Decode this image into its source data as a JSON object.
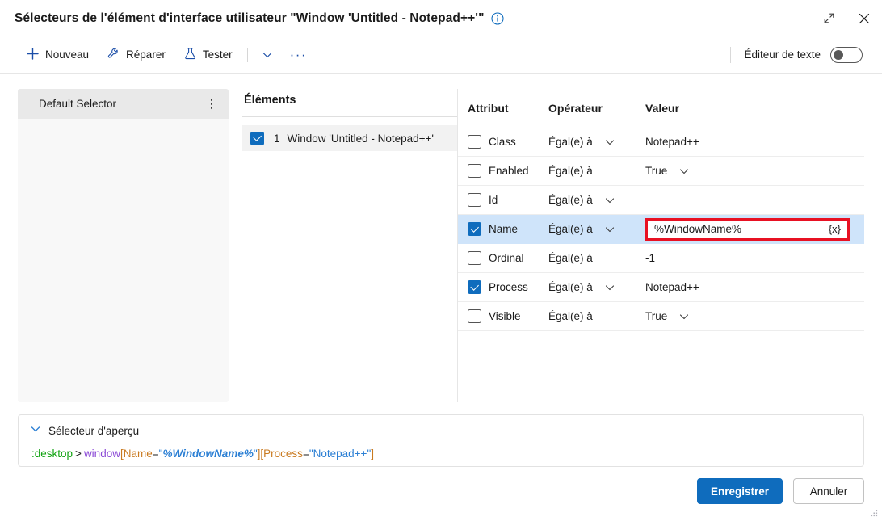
{
  "window": {
    "title": "Sélecteurs de l'élément d'interface utilisateur \"Window 'Untitled - Notepad++'\"",
    "info_icon": "info-circle-icon",
    "restore_icon": "restore-window-icon",
    "close_icon": "close-icon"
  },
  "toolbar": {
    "new_label": "Nouveau",
    "new_icon": "plus-icon",
    "repair_label": "Réparer",
    "repair_icon": "wrench-icon",
    "test_label": "Tester",
    "test_icon": "flask-icon",
    "dropdown_icon": "chevron-down-icon",
    "overflow_icon": "ellipsis-horizontal-icon",
    "text_editor_label": "Éditeur de texte",
    "text_editor_state": "off"
  },
  "left_panel": {
    "header_label": "Default Selector",
    "more_icon": "ellipsis-vertical-icon"
  },
  "elements": {
    "title": "Éléments",
    "items": [
      {
        "index": "1",
        "label": "Window 'Untitled - Notepad++'",
        "checked": true
      }
    ]
  },
  "attributes": {
    "columns": {
      "attribute": "Attribut",
      "operator": "Opérateur",
      "value": "Valeur"
    },
    "rows": [
      {
        "name": "Class",
        "checked": false,
        "operator": "Égal(e) à",
        "operator_has_chevron": true,
        "value": "Notepad++",
        "value_has_chevron": false,
        "selected": false,
        "editing": false
      },
      {
        "name": "Enabled",
        "checked": false,
        "operator": "Égal(e) à",
        "operator_has_chevron": false,
        "value": "True",
        "value_has_chevron": true,
        "selected": false,
        "editing": false
      },
      {
        "name": "Id",
        "checked": false,
        "operator": "Égal(e) à",
        "operator_has_chevron": true,
        "value": "",
        "value_has_chevron": false,
        "selected": false,
        "editing": false
      },
      {
        "name": "Name",
        "checked": true,
        "operator": "Égal(e) à",
        "operator_has_chevron": true,
        "value": "%WindowName%",
        "value_has_chevron": false,
        "selected": true,
        "editing": true,
        "variable_button": "{x}"
      },
      {
        "name": "Ordinal",
        "checked": false,
        "operator": "Égal(e) à",
        "operator_has_chevron": false,
        "value": "-1",
        "value_has_chevron": false,
        "selected": false,
        "editing": false
      },
      {
        "name": "Process",
        "checked": true,
        "operator": "Égal(e) à",
        "operator_has_chevron": true,
        "value": "Notepad++",
        "value_has_chevron": false,
        "selected": false,
        "editing": false
      },
      {
        "name": "Visible",
        "checked": false,
        "operator": "Égal(e) à",
        "operator_has_chevron": false,
        "value": "True",
        "value_has_chevron": true,
        "selected": false,
        "editing": false
      }
    ]
  },
  "preview": {
    "header_label": "Sélecteur d'aperçu",
    "expand_icon": "chevron-down-icon",
    "tokens": {
      "desktop": ":desktop",
      "combinator": ">",
      "tag": "window",
      "open_bracket_1": "[",
      "attr_1": "Name",
      "eq_1": "=",
      "quote_open_1": "\"",
      "value_1": "%WindowName%",
      "quote_close_1": "\"",
      "close_bracket_1": "]",
      "open_bracket_2": "[",
      "attr_2": "Process",
      "eq_2": "=",
      "quote_open_2": "\"",
      "value_2": "Notepad++",
      "quote_close_2": "\"",
      "close_bracket_2": "]"
    }
  },
  "footer": {
    "save_label": "Enregistrer",
    "cancel_label": "Annuler"
  },
  "colors": {
    "accent": "#0f6cbd",
    "highlight_row": "#cfe4fa",
    "error_outline": "#e81123",
    "toolbar_icon": "#1b4ea8"
  }
}
